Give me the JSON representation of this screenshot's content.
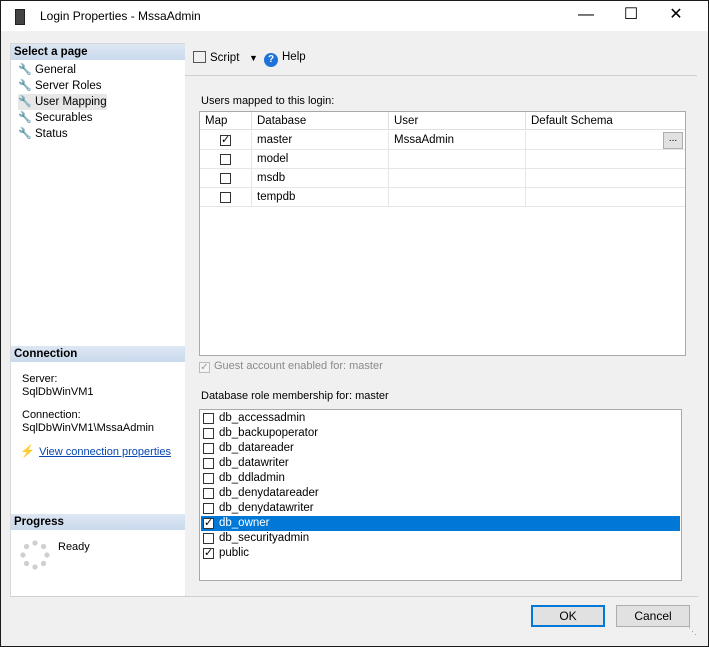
{
  "window": {
    "title": "Login Properties - MssaAdmin"
  },
  "left": {
    "select_page_title": "Select a page",
    "pages": [
      "General",
      "Server Roles",
      "User Mapping",
      "Securables",
      "Status"
    ],
    "connection_title": "Connection",
    "server_label": "Server:",
    "server_value": "SqlDbWinVM1",
    "connection_label": "Connection:",
    "connection_value": "SqlDbWinVM1\\MssaAdmin",
    "view_link": "View connection properties",
    "progress_title": "Progress",
    "progress_status": "Ready"
  },
  "toolbar": {
    "script_label": "Script",
    "help_label": "Help"
  },
  "mapping": {
    "label": "Users mapped to this login:",
    "headers": [
      "Map",
      "Database",
      "User",
      "Default Schema"
    ],
    "rows": [
      {
        "checked": true,
        "database": "master",
        "user": "MssaAdmin",
        "schema": ""
      },
      {
        "checked": false,
        "database": "model",
        "user": "",
        "schema": ""
      },
      {
        "checked": false,
        "database": "msdb",
        "user": "",
        "schema": ""
      },
      {
        "checked": false,
        "database": "tempdb",
        "user": "",
        "schema": ""
      }
    ],
    "ellipsis": "..."
  },
  "guest": {
    "label": "Guest account enabled for: master",
    "checked": true
  },
  "roles": {
    "label": "Database role membership for: master",
    "items": [
      {
        "name": "db_accessadmin",
        "checked": false
      },
      {
        "name": "db_backupoperator",
        "checked": false
      },
      {
        "name": "db_datareader",
        "checked": false
      },
      {
        "name": "db_datawriter",
        "checked": false
      },
      {
        "name": "db_ddladmin",
        "checked": false
      },
      {
        "name": "db_denydatareader",
        "checked": false
      },
      {
        "name": "db_denydatawriter",
        "checked": false
      },
      {
        "name": "db_owner",
        "checked": true
      },
      {
        "name": "db_securityadmin",
        "checked": false
      },
      {
        "name": "public",
        "checked": true
      }
    ],
    "selected_index": 7
  },
  "buttons": {
    "ok": "OK",
    "cancel": "Cancel"
  },
  "colors": {
    "selection": "#0078d7",
    "link": "#0645ad",
    "section_header": "#c9d9ec"
  }
}
